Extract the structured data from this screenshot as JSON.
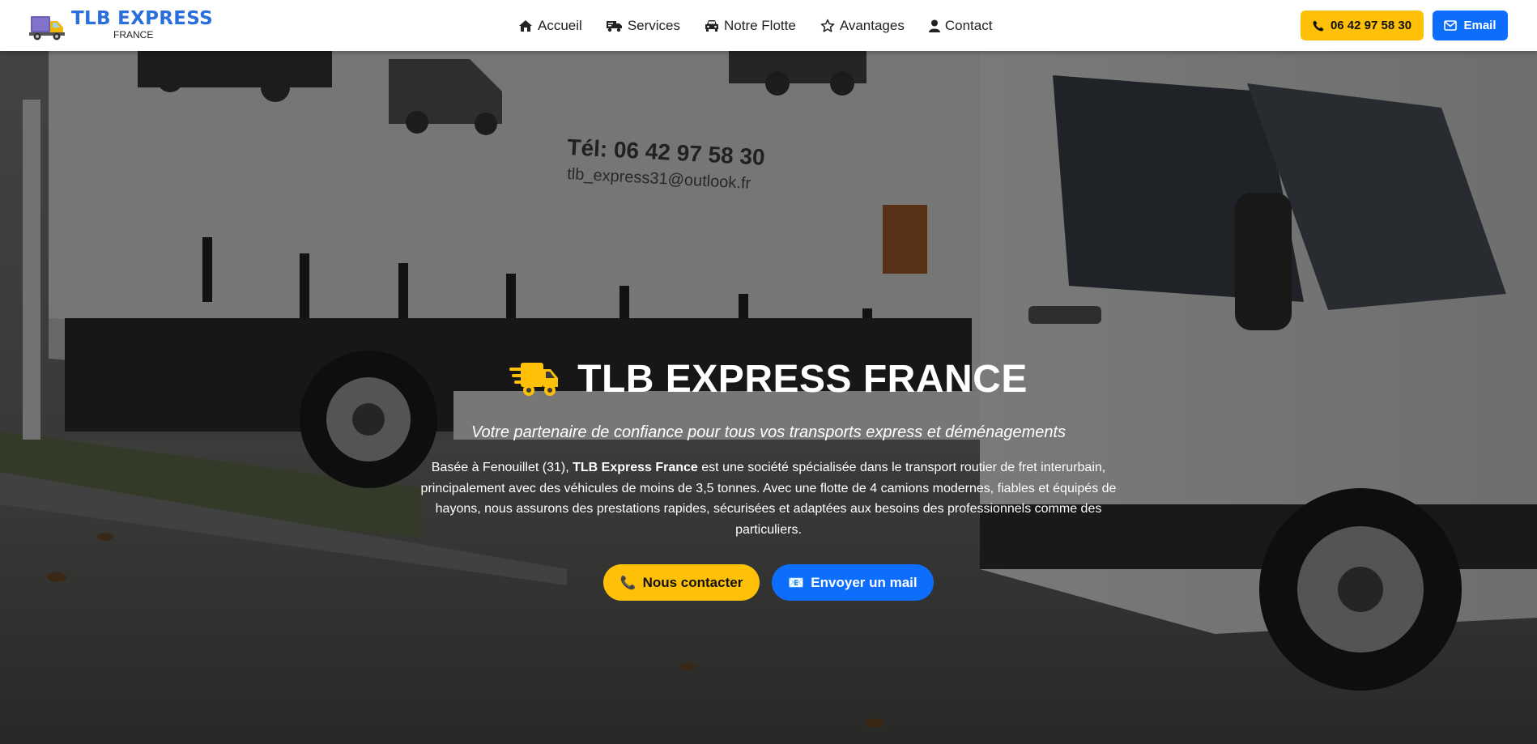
{
  "brand": {
    "name": "TLB EXPRESS",
    "subtitle": "FRANCE"
  },
  "nav": {
    "items": [
      {
        "label": "Accueil",
        "icon": "home-icon"
      },
      {
        "label": "Services",
        "icon": "truck-fast-icon"
      },
      {
        "label": "Notre Flotte",
        "icon": "car-icon"
      },
      {
        "label": "Avantages",
        "icon": "star-icon"
      },
      {
        "label": "Contact",
        "icon": "user-icon"
      }
    ],
    "phone_button": "06 42 97 58 30",
    "email_button": "Email"
  },
  "hero": {
    "title": "TLB EXPRESS FRANCE",
    "subtitle": "Votre partenaire de confiance pour tous vos transports express et déménagements",
    "desc_prefix": "Basée à Fenouillet (31), ",
    "desc_bold": "TLB Express France",
    "desc_suffix": " est une société spécialisée dans le transport routier de fret interurbain, principalement avec des véhicules de moins de 3,5 tonnes. Avec une flotte de 4 camions modernes, fiables et équipés de hayons, nous assurons des prestations rapides, sécurisées et adaptées aux besoins des professionnels comme des particuliers.",
    "cta_contact": "Nous contacter",
    "cta_mail": "Envoyer un mail",
    "truck_tel": "Tél: 06 42 97 58 30",
    "truck_email": "tlb_express31@outlook.fr"
  },
  "colors": {
    "accent_yellow": "#ffc107",
    "accent_blue": "#0d6efd",
    "brand_blue": "#2a6fdb"
  }
}
